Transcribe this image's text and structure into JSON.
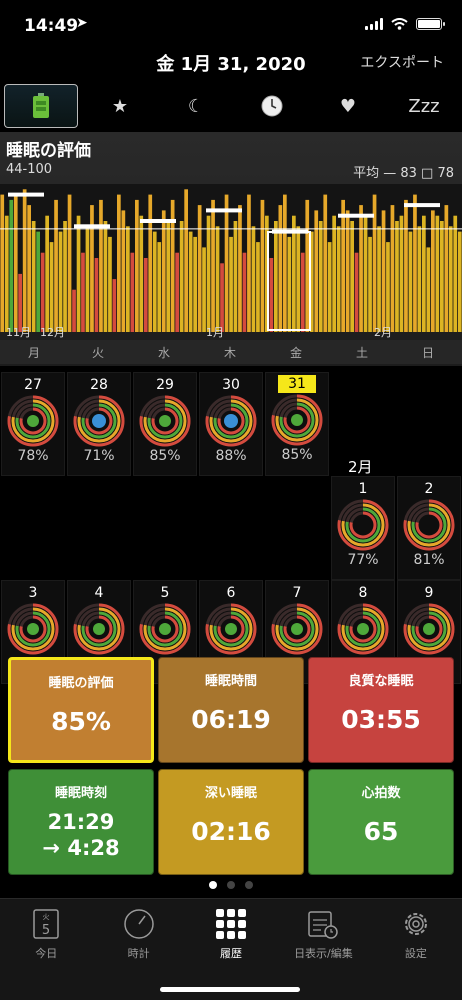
{
  "status_bar": {
    "time": "14:49"
  },
  "header": {
    "date": "金 1月 31, 2020",
    "export_label": "エクスポート"
  },
  "icon_tabs": [
    {
      "icon": "battery-icon",
      "glyph": ""
    },
    {
      "icon": "star-icon",
      "glyph": "★"
    },
    {
      "icon": "moon-icon",
      "glyph": "☾"
    },
    {
      "icon": "clock-icon",
      "glyph": ""
    },
    {
      "icon": "heart-icon",
      "glyph": "♥"
    },
    {
      "icon": "zzz-icon",
      "glyph": "Zzz"
    }
  ],
  "chart": {
    "title": "睡眠の評価",
    "range": "44-100",
    "average_label": "平均 — 83",
    "legend_value": "□ 78",
    "month_labels": [
      "11月",
      "12月",
      "1月",
      "2月"
    ],
    "weekday_labels": [
      "月",
      "火",
      "水",
      "木",
      "金",
      "土",
      "日"
    ]
  },
  "chart_data": {
    "type": "bar",
    "ylim": [
      44,
      100
    ],
    "average": 83,
    "values": [
      96,
      88,
      94,
      96,
      66,
      98,
      92,
      86,
      82,
      74,
      88,
      78,
      94,
      82,
      86,
      96,
      60,
      88,
      74,
      84,
      92,
      72,
      94,
      86,
      80,
      64,
      96,
      90,
      84,
      74,
      94,
      88,
      72,
      96,
      82,
      78,
      90,
      86,
      94,
      74,
      86,
      98,
      82,
      80,
      92,
      76,
      88,
      94,
      84,
      70,
      96,
      80,
      86,
      92,
      74,
      96,
      84,
      78,
      94,
      88,
      72,
      86,
      92,
      96,
      80,
      88,
      84,
      74,
      94,
      82,
      90,
      86,
      96,
      78,
      88,
      84,
      94,
      90,
      86,
      74,
      92,
      88,
      80,
      96,
      84,
      90,
      78,
      92,
      86,
      88,
      94,
      82,
      96,
      84,
      88,
      76,
      90,
      88,
      86,
      92,
      84,
      88,
      82
    ],
    "weekly_avg": [
      96,
      84,
      86,
      90,
      82,
      88,
      92
    ],
    "colors": {
      "high": "#e6a82a",
      "mid": "#dcb423",
      "low": "#d44b3e",
      "green": "#4ea83a"
    }
  },
  "calendar": {
    "feb_label": "2月",
    "row1": [
      {
        "day": "27",
        "pct": "78%",
        "today": false,
        "center": "green"
      },
      {
        "day": "28",
        "pct": "71%",
        "today": false,
        "center": "blue"
      },
      {
        "day": "29",
        "pct": "85%",
        "today": false,
        "center": "green"
      },
      {
        "day": "30",
        "pct": "88%",
        "today": false,
        "center": "blue"
      },
      {
        "day": "31",
        "pct": "85%",
        "today": true,
        "center": "green"
      }
    ],
    "row2": [
      {
        "day": "1",
        "pct": "77%",
        "today": false,
        "center": "none"
      },
      {
        "day": "2",
        "pct": "81%",
        "today": false,
        "center": "none"
      }
    ],
    "row3": [
      {
        "day": "3",
        "center": "green"
      },
      {
        "day": "4",
        "center": "green"
      },
      {
        "day": "5",
        "center": "green"
      },
      {
        "day": "6",
        "center": "green"
      },
      {
        "day": "7",
        "center": "green"
      },
      {
        "day": "8",
        "center": "green"
      },
      {
        "day": "9",
        "center": "green"
      }
    ]
  },
  "tiles": [
    {
      "label": "睡眠の評価",
      "value": "85%",
      "color": "#c17f31",
      "selected": true
    },
    {
      "label": "睡眠時間",
      "value": "06:19",
      "color": "#a7752d",
      "selected": false
    },
    {
      "label": "良質な睡眠",
      "value": "03:55",
      "color": "#c6433f",
      "selected": false
    },
    {
      "label": "睡眠時刻",
      "value": "21:29",
      "value2": "→ 4:28",
      "color": "#3f8f37",
      "selected": false
    },
    {
      "label": "深い睡眠",
      "value": "02:16",
      "color": "#c49a22",
      "selected": false
    },
    {
      "label": "心拍数",
      "value": "65",
      "color": "#4a9b3d",
      "selected": false
    }
  ],
  "tabbar": [
    {
      "label": "今日",
      "icon": "calendar-icon",
      "badge_top": "火",
      "badge_num": "5"
    },
    {
      "label": "時計",
      "icon": "gauge-icon"
    },
    {
      "label": "履歴",
      "icon": "grid-icon"
    },
    {
      "label": "日表示/編集",
      "icon": "calendar-clock-icon"
    },
    {
      "label": "設定",
      "icon": "gear-icon"
    }
  ]
}
